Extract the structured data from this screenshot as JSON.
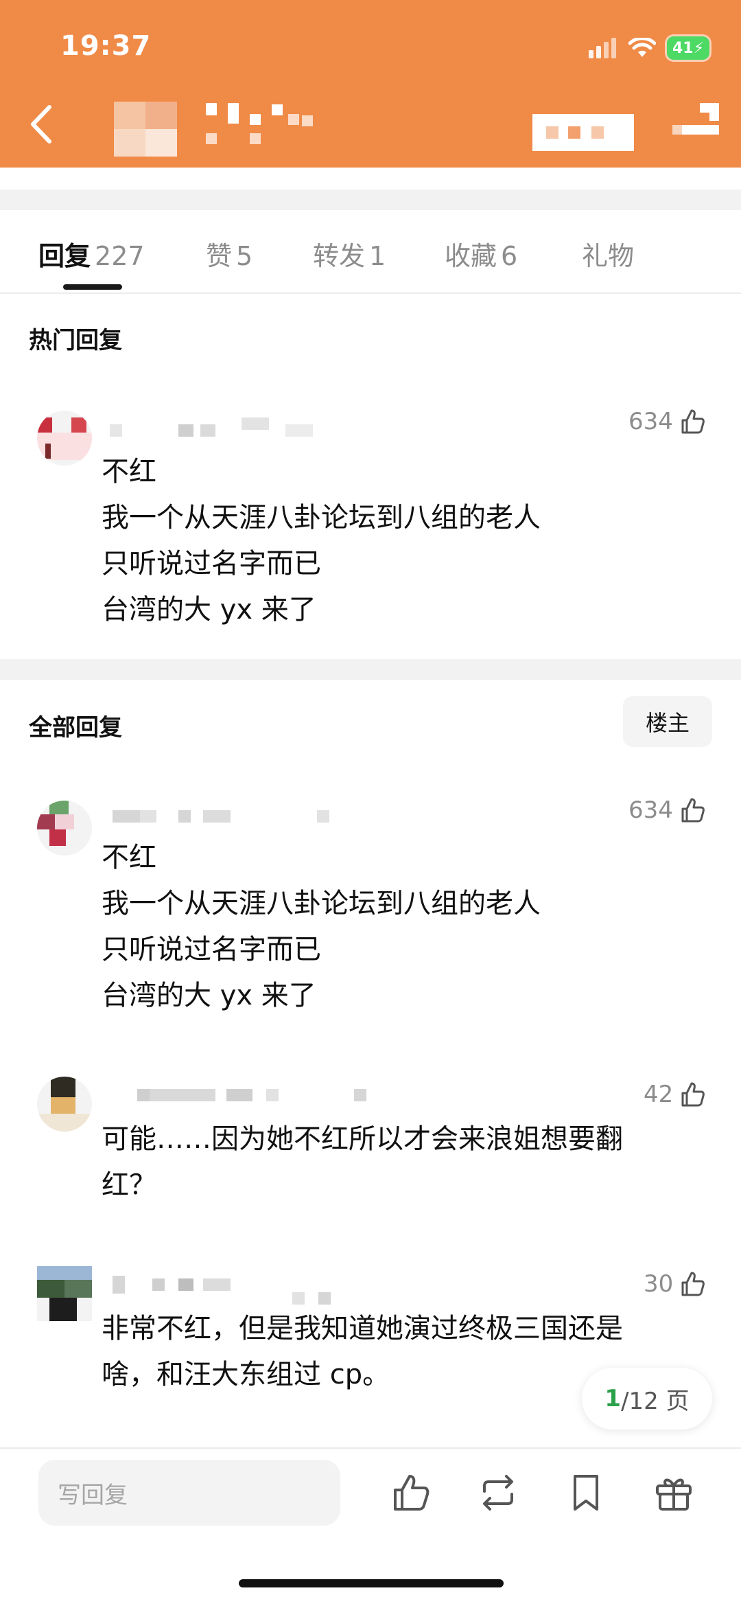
{
  "status_bar": {
    "time": "19:37",
    "battery": "41"
  },
  "tabs": [
    {
      "label": "回复",
      "count": "227"
    },
    {
      "label": "赞",
      "count": "5"
    },
    {
      "label": "转发",
      "count": "1"
    },
    {
      "label": "收藏",
      "count": "6"
    },
    {
      "label": "礼物",
      "count": ""
    }
  ],
  "hot_section": {
    "title": "热门回复"
  },
  "all_section": {
    "title": "全部回复",
    "owner_filter": "楼主"
  },
  "hot_replies": [
    {
      "likes": "634",
      "lines": [
        "不红",
        "我一个从天涯八卦论坛到八组的老人",
        "只听说过名字而已",
        "台湾的大 yx 来了"
      ]
    }
  ],
  "replies": [
    {
      "likes": "634",
      "lines": [
        "不红",
        "我一个从天涯八卦论坛到八组的老人",
        "只听说过名字而已",
        "台湾的大 yx 来了"
      ]
    },
    {
      "likes": "42",
      "lines": [
        "可能……因为她不红所以才会来浪姐想要翻",
        "红？"
      ]
    },
    {
      "likes": "30",
      "lines": [
        "非常不红，但是我知道她演过终极三国还是",
        "啥，和汪大东组过 cp。"
      ]
    }
  ],
  "pager": {
    "current": "1",
    "total": "/12 页"
  },
  "bottom_bar": {
    "reply_placeholder": "写回复"
  },
  "icons": [
    "back-icon",
    "signal-icon",
    "wifi-icon",
    "battery-icon",
    "thumb-up-icon",
    "repost-icon",
    "bookmark-icon",
    "gift-icon"
  ],
  "colors": {
    "header": "#f08a47",
    "accent_green": "#2aa14a"
  }
}
